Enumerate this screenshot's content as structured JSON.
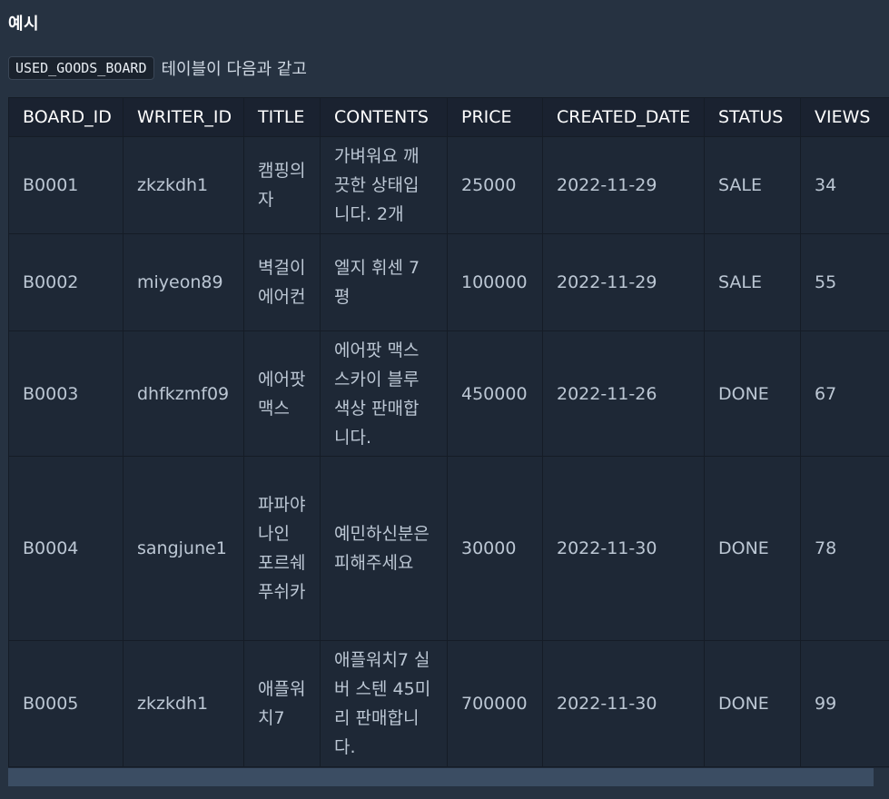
{
  "heading": "예시",
  "description": {
    "code": "USED_GOODS_BOARD",
    "text": "테이블이 다음과 같고"
  },
  "table": {
    "headers": [
      "BOARD_ID",
      "WRITER_ID",
      "TITLE",
      "CONTENTS",
      "PRICE",
      "CREATED_DATE",
      "STATUS",
      "VIEWS"
    ],
    "rows": [
      [
        "B0001",
        "zkzkdh1",
        "캠핑의자",
        "가벼워요 깨끗한 상태입니다. 2개",
        "25000",
        "2022-11-29",
        "SALE",
        "34"
      ],
      [
        "B0002",
        "miyeon89",
        "벽걸이 에어컨",
        "엘지 휘센 7평",
        "100000",
        "2022-11-29",
        "SALE",
        "55"
      ],
      [
        "B0003",
        "dhfkzmf09",
        "에어팟 맥스",
        "에어팟 맥스 스카이 블루 색상 판매합니다.",
        "450000",
        "2022-11-26",
        "DONE",
        "67"
      ],
      [
        "B0004",
        "sangjune1",
        "파파야나인 포르쉐 푸쉬카",
        "예민하신분은 피해주세요",
        "30000",
        "2022-11-30",
        "DONE",
        "78"
      ],
      [
        "B0005",
        "zkzkdh1",
        "애플워치7",
        "애플워치7 실버 스텐 45미리 판매합니다.",
        "700000",
        "2022-11-30",
        "DONE",
        "99"
      ]
    ]
  }
}
